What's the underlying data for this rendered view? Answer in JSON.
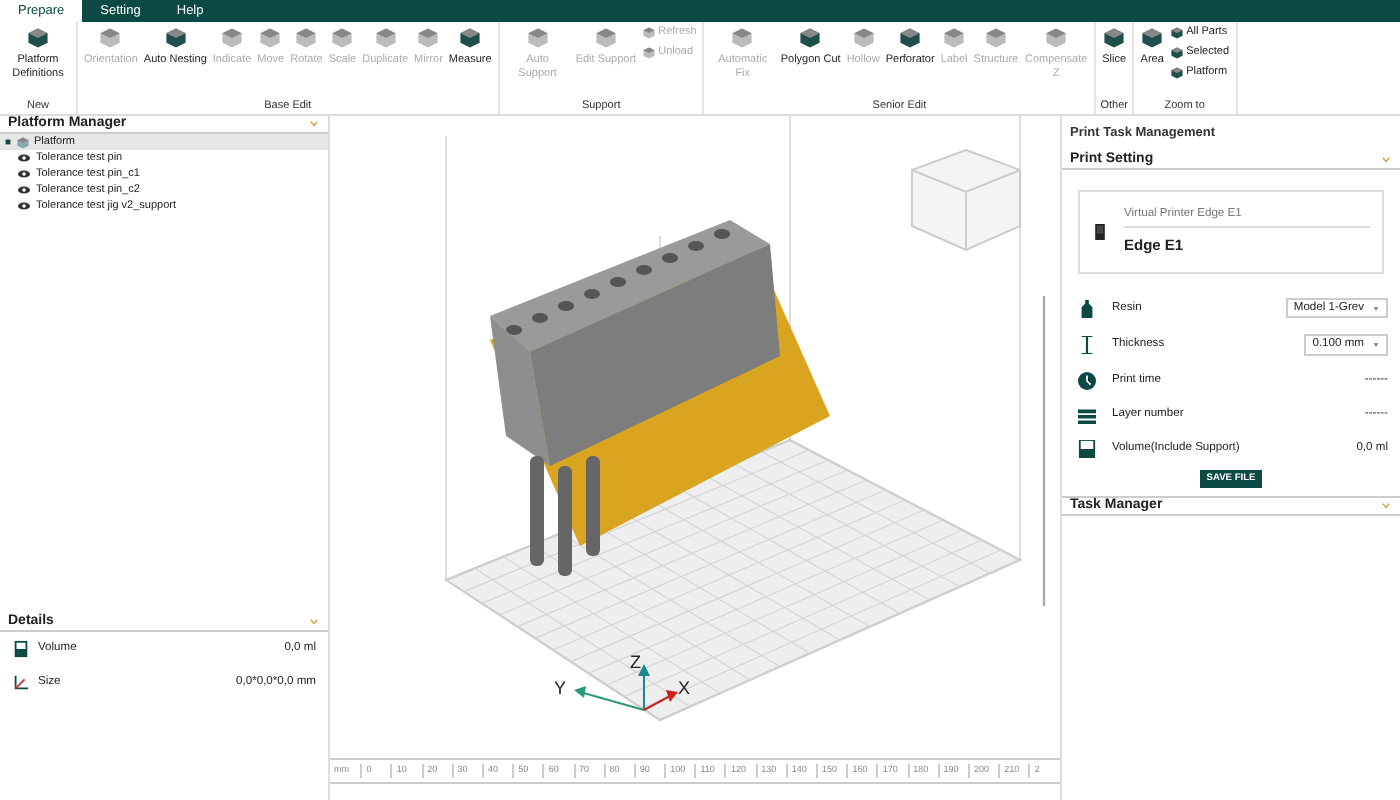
{
  "menu_tabs": [
    {
      "label": "Prepare",
      "selected": true
    },
    {
      "label": "Setting",
      "selected": false
    },
    {
      "label": "Help",
      "selected": false
    }
  ],
  "ribbon_groups": [
    {
      "label": "New",
      "tools": [
        {
          "label": "Platform Definitions",
          "kind": "large",
          "disabled": false
        }
      ]
    },
    {
      "label": "Base Edit",
      "tools": [
        {
          "label": "Orientation",
          "kind": "large",
          "disabled": true
        },
        {
          "label": "Auto Nesting",
          "kind": "large",
          "disabled": false
        },
        {
          "label": "Indicate",
          "kind": "large",
          "disabled": true
        },
        {
          "label": "Move",
          "kind": "large",
          "disabled": true
        },
        {
          "label": "Rotate",
          "kind": "large",
          "disabled": true
        },
        {
          "label": "Scale",
          "kind": "large",
          "disabled": true
        },
        {
          "label": "Duplicate",
          "kind": "large",
          "disabled": true
        },
        {
          "label": "Mirror",
          "kind": "large",
          "disabled": true
        },
        {
          "label": "Measure",
          "kind": "large",
          "disabled": false
        }
      ]
    },
    {
      "label": "Support",
      "tools": [
        {
          "label": "Auto Support",
          "kind": "large",
          "disabled": true
        },
        {
          "label": "Edit Support",
          "kind": "large",
          "disabled": true
        },
        {
          "label": "Refresh",
          "kind": "small",
          "disabled": true
        },
        {
          "label": "Unload",
          "kind": "small",
          "disabled": true
        }
      ]
    },
    {
      "label": "Senior Edit",
      "tools": [
        {
          "label": "Automatic Fix",
          "kind": "large",
          "disabled": true
        },
        {
          "label": "Polygon Cut",
          "kind": "large",
          "disabled": false
        },
        {
          "label": "Hollow",
          "kind": "large",
          "disabled": true
        },
        {
          "label": "Perforator",
          "kind": "large",
          "disabled": false
        },
        {
          "label": "Label",
          "kind": "large",
          "disabled": true
        },
        {
          "label": "Structure",
          "kind": "large",
          "disabled": true
        },
        {
          "label": "Compensate Z",
          "kind": "large",
          "disabled": true
        }
      ]
    },
    {
      "label": "Other",
      "tools": [
        {
          "label": "Slice",
          "kind": "large",
          "disabled": false
        }
      ]
    },
    {
      "label": "Zoom to",
      "tools": [
        {
          "label": "Area",
          "kind": "large",
          "disabled": false
        },
        {
          "label": "All Parts",
          "kind": "small",
          "disabled": false
        },
        {
          "label": "Selected",
          "kind": "small",
          "disabled": false
        },
        {
          "label": "Platform",
          "kind": "small",
          "disabled": false
        }
      ]
    }
  ],
  "platform_manager": {
    "title": "Platform Manager",
    "tree": [
      {
        "label": "Platform",
        "selected": true,
        "expanded": true,
        "children": [
          {
            "label": "Tolerance test pin",
            "selected": false
          },
          {
            "label": "Tolerance test pin_c1",
            "selected": false
          },
          {
            "label": "Tolerance test pin_c2",
            "selected": false
          },
          {
            "label": "Tolerance test jig v2_support",
            "selected": false
          }
        ]
      }
    ]
  },
  "details": {
    "title": "Details",
    "rows": [
      {
        "label": "Volume",
        "value": "0,0 ml"
      },
      {
        "label": "Size",
        "value": "0,0*0,0*0,0 mm"
      }
    ]
  },
  "viewport": {
    "axes": [
      {
        "label": "Y",
        "kind": "y"
      },
      {
        "label": "Z",
        "kind": "z"
      },
      {
        "label": "X",
        "kind": "x"
      }
    ],
    "ruler": {
      "unit": "mm",
      "ticks": [
        "0",
        "10",
        "20",
        "30",
        "40",
        "50",
        "60",
        "70",
        "80",
        "90",
        "100",
        "110",
        "120",
        "130",
        "140",
        "150",
        "160",
        "170",
        "180",
        "190",
        "200",
        "210",
        "2"
      ]
    }
  },
  "print_task": {
    "title": "Print Task Management",
    "print_setting": {
      "title": "Print Setting",
      "expanded": true,
      "printer": {
        "name": "Virtual Printer Edge E1",
        "model": "Edge E1"
      },
      "rows": [
        {
          "label": "Resin",
          "kind": "select",
          "value": "Model 1-Grev"
        },
        {
          "label": "Thickness",
          "kind": "select",
          "value": "0.100 mm"
        },
        {
          "label": "Print time",
          "kind": "text",
          "value": "------"
        },
        {
          "label": "Layer number",
          "kind": "text",
          "value": "------"
        },
        {
          "label": "Volume(Include Support)",
          "kind": "text",
          "value": "0,0 ml"
        }
      ],
      "save_button": "SAVE FILE"
    },
    "task_manager": {
      "title": "Task Manager",
      "expanded": false
    }
  }
}
